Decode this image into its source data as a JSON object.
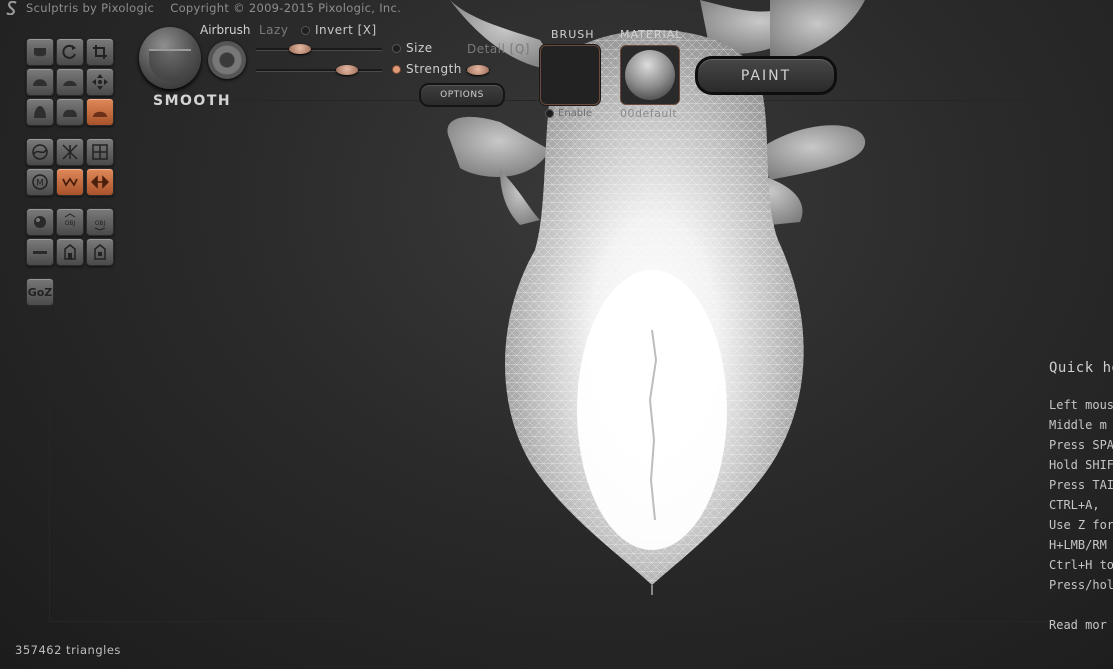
{
  "app": {
    "title": "Sculptris by Pixologic",
    "copyright": "Copyright © 2009-2015 Pixologic, Inc."
  },
  "tools": {
    "rows": [
      [
        "draw-icon",
        "rotate-icon",
        "crop-icon"
      ],
      [
        "inflate-icon",
        "pinch-icon",
        "move-icon"
      ],
      [
        "flatten-icon",
        "grab-icon",
        "smooth-icon"
      ],
      [
        "wireframe-toggle-icon",
        "symmetry-off-icon",
        "grid-icon"
      ],
      [
        "mask-icon",
        "reduce-icon",
        "mirror-icon"
      ],
      [
        "sphere-icon",
        "import-obj-icon",
        "export-obj-icon"
      ],
      [
        "plane-icon",
        "open-icon",
        "save-icon"
      ]
    ],
    "active": [
      "smooth-icon",
      "reduce-icon",
      "mirror-icon"
    ],
    "goz_label": "GoZ"
  },
  "brush": {
    "name": "SMOOTH",
    "airbrush_label": "Airbrush",
    "lazy_label": "Lazy",
    "invert_label": "Invert [X]",
    "size_label": "Size",
    "strength_label": "Strength",
    "detail_label": "Detail [Q]",
    "size_value": 0.35,
    "strength_value": 0.72,
    "detail_value": 0.5,
    "options_label": "OPTIONS"
  },
  "brush_panel": {
    "title": "BRUSH",
    "enable_label": "Enable"
  },
  "material_panel": {
    "title": "MATERIAL",
    "name": "00default"
  },
  "paint_button": "PAINT",
  "help": {
    "title": "Quick he",
    "lines": [
      "Left mous",
      "Middle m",
      "Press SPA",
      "Hold SHIF",
      "Press TAI",
      "CTRL+A,",
      "Use Z for",
      "H+LMB/RM",
      "Ctrl+H to",
      "Press/hol"
    ],
    "more": "Read mor"
  },
  "status": {
    "triangles": "357462 triangles"
  },
  "colors": {
    "accent": "#d9784a",
    "background": "#2a2a2a"
  }
}
